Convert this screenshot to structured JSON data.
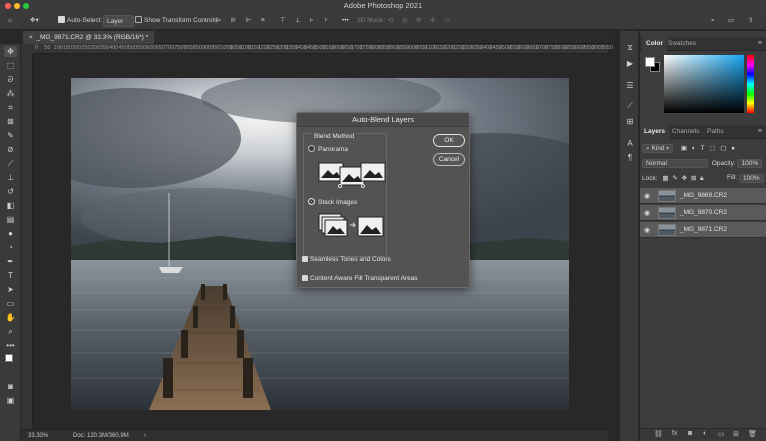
{
  "window": {
    "title": "Adobe Photoshop 2021"
  },
  "options_bar": {
    "auto_select_label": "Auto-Select:",
    "auto_select_value": "Layer",
    "show_transform_label": "Show Transform Controls",
    "mode_3d_label": "3D Mode:"
  },
  "document": {
    "tab_title": "_MG_9871.CR2 @ 33.3% (RGB/16*) *",
    "zoom": "33.33%",
    "doc_size": "Doc: 120.3M/360.9M"
  },
  "ruler_top": [
    "0",
    "50",
    "100",
    "150",
    "200",
    "250",
    "300",
    "350",
    "400",
    "450",
    "500",
    "550",
    "600",
    "650",
    "700",
    "750",
    "800",
    "850",
    "900",
    "950",
    "1000",
    "1050",
    "1100",
    "1150",
    "1200",
    "1250",
    "1300",
    "1350",
    "1400",
    "1450",
    "1500",
    "1550",
    "1600",
    "1650",
    "1700",
    "1750",
    "1800",
    "1850",
    "1900",
    "1950",
    "2000",
    "2050",
    "2100",
    "2150",
    "2200",
    "2250",
    "2300",
    "2350",
    "2400",
    "2450",
    "2500",
    "2550",
    "2600",
    "2650",
    "2700",
    "2750",
    "2800",
    "2850",
    "2900",
    "2950",
    "3000",
    "3050"
  ],
  "dialog": {
    "title": "Auto-Blend Layers",
    "group_label": "Blend Method",
    "panorama_label": "Panorama",
    "stack_label": "Stack Images",
    "selected": "Stack Images",
    "ok_label": "OK",
    "cancel_label": "Cancel",
    "seamless_label": "Seamless Tones and Colors",
    "seamless_checked": true,
    "content_aware_label": "Content Aware Fill Transparent Areas",
    "content_aware_checked": true
  },
  "color_panel": {
    "tabs": [
      "Color",
      "Swatches"
    ],
    "foreground": "#ffffff",
    "background": "#000000",
    "hue_color": "#16a6f2"
  },
  "layers_panel": {
    "tabs": [
      "Layers",
      "Channels",
      "Paths"
    ],
    "filter_label": "Kind",
    "blend_mode": "Normal",
    "opacity_label": "Opacity:",
    "opacity_value": "100%",
    "lock_label": "Lock:",
    "fill_label": "Fill:",
    "fill_value": "100%",
    "layers": [
      {
        "name": "_MG_9869.CR2"
      },
      {
        "name": "_MG_9870.CR2"
      },
      {
        "name": "_MG_9871.CR2"
      }
    ]
  }
}
